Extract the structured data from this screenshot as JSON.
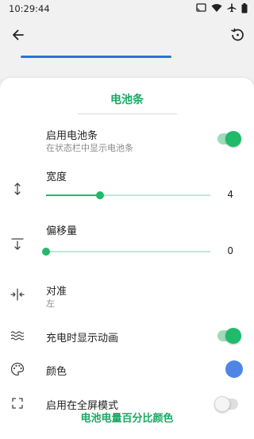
{
  "status_bar": {
    "time": "10:29:44",
    "icons": [
      "cast-icon",
      "wifi-icon",
      "airplane-icon",
      "battery-icon"
    ]
  },
  "app_bar": {
    "back_icon": "arrow-left-icon",
    "history_icon": "history-icon",
    "preview_bar_color": "#2f6fde"
  },
  "sheet": {
    "title": "电池条",
    "rows": {
      "enable": {
        "title": "启用电池条",
        "subtitle": "在状态栏中显示电池条",
        "enabled": true
      },
      "width": {
        "title": "宽度",
        "value": "4",
        "level": 0.33
      },
      "offset": {
        "title": "偏移量",
        "value": "0",
        "level": 0
      },
      "align": {
        "title": "对准",
        "subtitle": "左"
      },
      "charging_anim": {
        "title": "充电时显示动画",
        "enabled": true
      },
      "color": {
        "title": "颜色",
        "swatch": "#4f86e6"
      },
      "fullscreen": {
        "title": "启用在全屏模式",
        "enabled": false
      }
    },
    "next_section": "电池电量百分比颜色"
  },
  "colors": {
    "accent_green": "#1fba6a",
    "title_green": "#1aa864",
    "preview_blue": "#2f6fde"
  }
}
